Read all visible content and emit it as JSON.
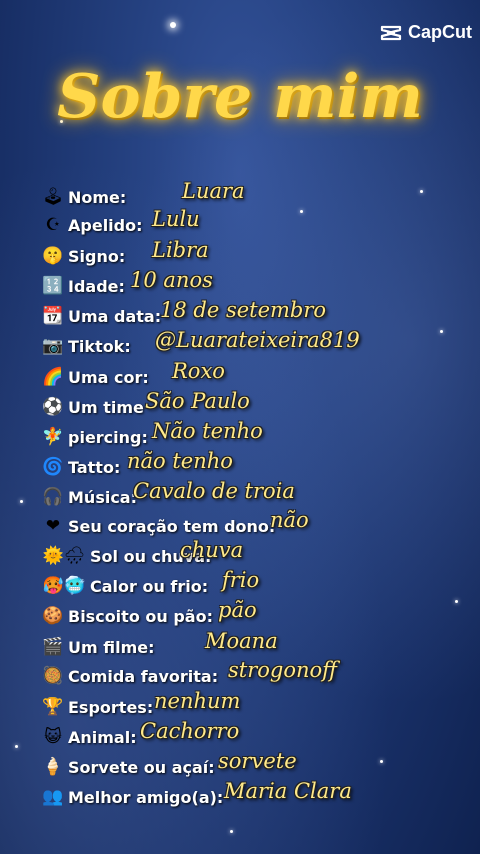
{
  "brand": {
    "name": "CapCut"
  },
  "title": "Sobre mim",
  "rows": [
    {
      "icon": "joystick-icon",
      "glyph": "🕹",
      "label": "Nome:",
      "value": "Luara"
    },
    {
      "icon": "moon-icon",
      "glyph": "☪",
      "label": "Apelido:",
      "value": "Lulu"
    },
    {
      "icon": "face-icon",
      "glyph": "🤫",
      "label": "Signo:",
      "value": "Libra"
    },
    {
      "icon": "numbers-icon",
      "glyph": "🔢",
      "label": "Idade:",
      "value": "10 anos"
    },
    {
      "icon": "calendar-icon",
      "glyph": "📆",
      "label": "Uma data:",
      "value": "18 de setembro"
    },
    {
      "icon": "camera-icon",
      "glyph": "📷",
      "label": "Tiktok:",
      "value": "@Luarateixeira819"
    },
    {
      "icon": "rainbow-icon",
      "glyph": "🌈",
      "label": "Uma cor:",
      "value": "Roxo"
    },
    {
      "icon": "soccer-ball-icon",
      "glyph": "⚽",
      "label": "Um time",
      "value": "São Paulo"
    },
    {
      "icon": "fairy-icon",
      "glyph": "🧚",
      "label": "piercing:",
      "value": "Não tenho"
    },
    {
      "icon": "cyclone-icon",
      "glyph": "🌀",
      "label": "Tatto:",
      "value": "não tenho"
    },
    {
      "icon": "headphones-icon",
      "glyph": "🎧",
      "label": "Música:",
      "value": "Cavalo de troia"
    },
    {
      "icon": "heart-icon",
      "glyph": "❤",
      "label": "Seu coração tem dono:",
      "value": "não"
    },
    {
      "icon": "sun-rain-icon",
      "glyph": "🌞🌧",
      "label": "Sol ou chuva:",
      "value": "chuva"
    },
    {
      "icon": "hot-cold-face-icon",
      "glyph": "🥵🥶",
      "label": "Calor ou frio:",
      "value": "frio"
    },
    {
      "icon": "cookie-icon",
      "glyph": "🍪",
      "label": "Biscoito ou pão:",
      "value": "pão"
    },
    {
      "icon": "clapper-icon",
      "glyph": "🎬",
      "label": "Um filme:",
      "value": "Moana"
    },
    {
      "icon": "bowl-icon",
      "glyph": "🥘",
      "label": "Comida favorita:",
      "value": "strogonoff"
    },
    {
      "icon": "trophy-icon",
      "glyph": "🏆",
      "label": "Esportes:",
      "value": "nenhum"
    },
    {
      "icon": "cat-icon",
      "glyph": "😺",
      "label": "Animal:",
      "value": "Cachorro"
    },
    {
      "icon": "ice-cream-icon",
      "glyph": "🍦",
      "label": "Sorvete ou açaí:",
      "value": "sorvete"
    },
    {
      "icon": "people-icon",
      "glyph": "👥",
      "label": "Melhor amigo(a):",
      "value": "Maria Clara"
    }
  ]
}
